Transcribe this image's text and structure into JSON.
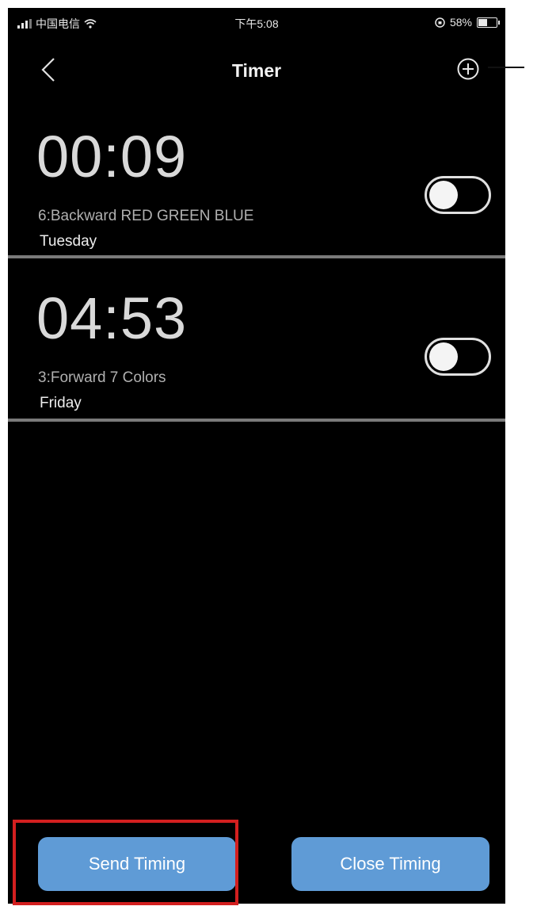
{
  "status_bar": {
    "carrier": "中国电信",
    "time": "下午5:08",
    "battery_text": "58%",
    "battery_level": 0.58
  },
  "header": {
    "title": "Timer",
    "back_icon": "chevron-left-icon",
    "add_icon": "plus-circle-icon"
  },
  "timers": [
    {
      "time": "00:09",
      "mode": "6:Backward RED GREEN BLUE",
      "day": "Tuesday",
      "enabled": false
    },
    {
      "time": "04:53",
      "mode": "3:Forward 7 Colors",
      "day": "Friday",
      "enabled": false
    }
  ],
  "buttons": {
    "send": "Send Timing",
    "close": "Close Timing"
  },
  "colors": {
    "background": "#000000",
    "button": "#5f9bd6",
    "highlight": "#d31f1f",
    "divider": "#7a7a7a"
  }
}
